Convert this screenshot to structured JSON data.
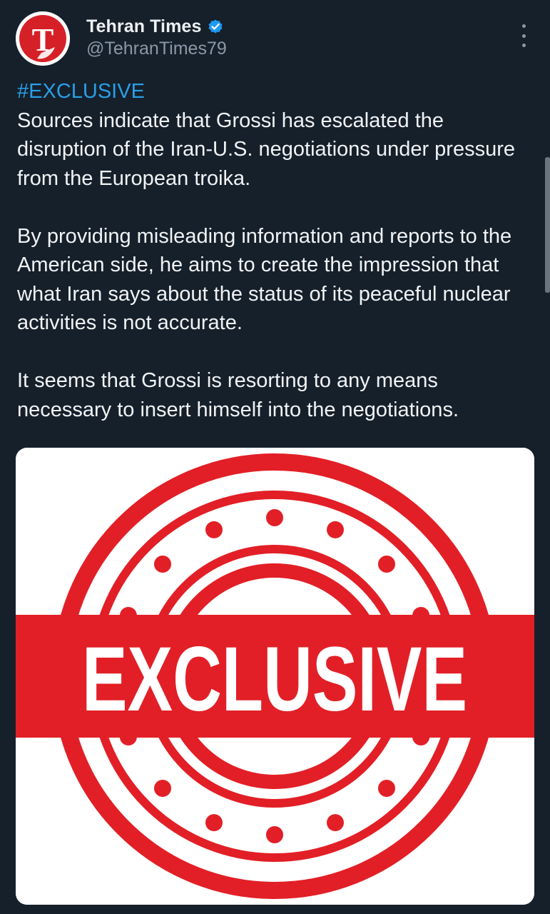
{
  "author": {
    "display_name": "Tehran Times",
    "handle": "@TehranTimes79",
    "avatar_letter": "T",
    "verified": true
  },
  "post": {
    "hashtag": "#EXCLUSIVE",
    "paragraphs": [
      "Sources indicate that Grossi has escalated the disruption of the Iran-U.S. negotiations under pressure from the European troika.",
      "By providing misleading information and reports to the American side, he aims to create the impression that what Iran says about the status of its peaceful nuclear activities is not accurate.",
      "It seems that Grossi is resorting to any means necessary to insert himself into the negotiations."
    ]
  },
  "media": {
    "stamp_text": "EXCLUSIVE",
    "stamp_color": "#e21f26"
  },
  "colors": {
    "background": "#15202b",
    "link": "#2a9fe6",
    "verified_badge": "#1d9bf0",
    "secondary_text": "#8b98a5"
  },
  "icons": {
    "verified": "verified-badge-icon",
    "more": "more-options-icon"
  }
}
